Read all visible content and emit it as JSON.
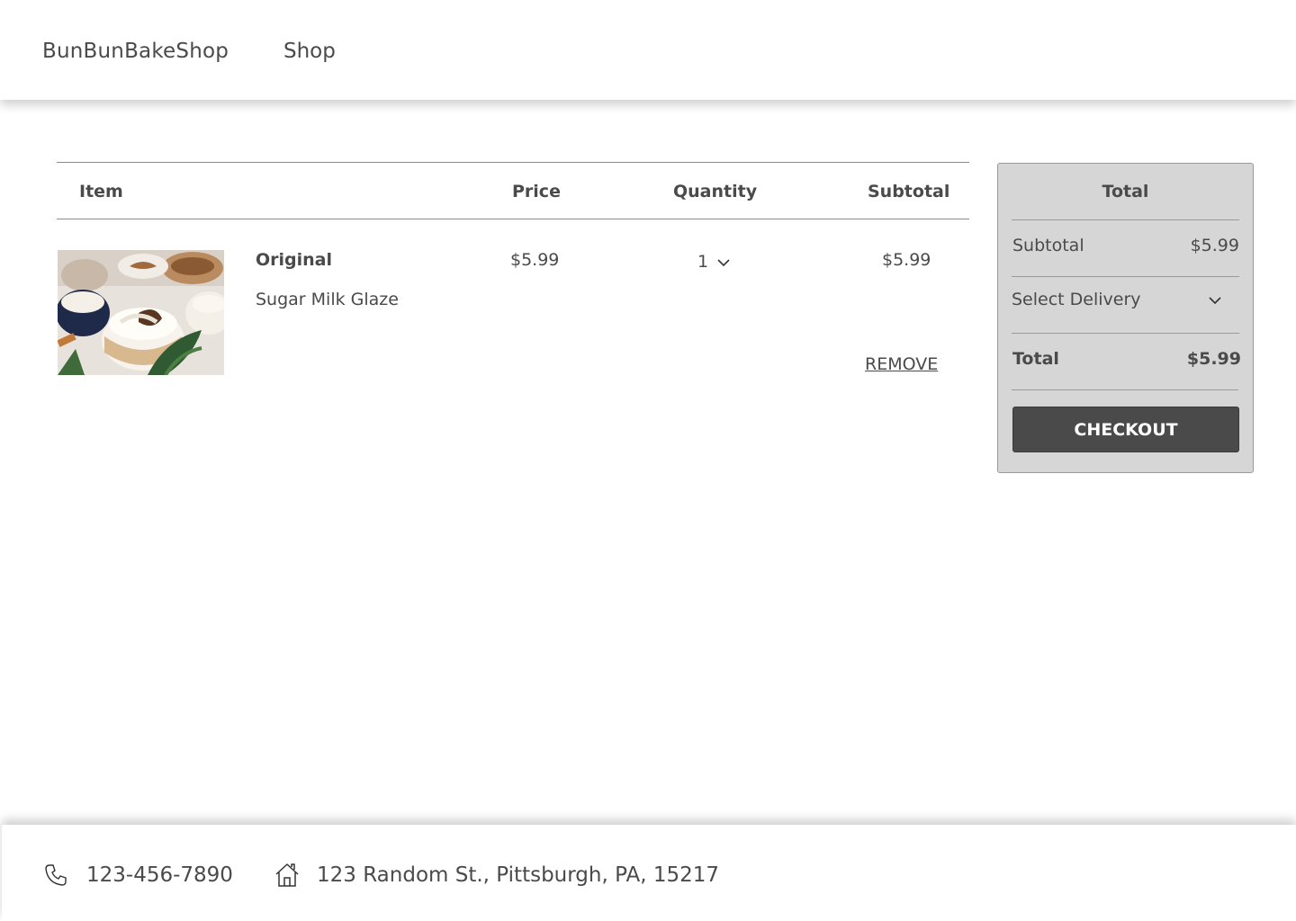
{
  "header": {
    "brand": "BunBunBakeShop",
    "nav_shop": "Shop"
  },
  "cart": {
    "columns": {
      "item": "Item",
      "price": "Price",
      "quantity": "Quantity",
      "subtotal": "Subtotal"
    },
    "items": [
      {
        "name": "Original",
        "variant": "Sugar Milk Glaze",
        "price": "$5.99",
        "quantity": "1",
        "subtotal": "$5.99",
        "remove_label": "REMOVE"
      }
    ]
  },
  "summary": {
    "title": "Total",
    "subtotal_label": "Subtotal",
    "subtotal_value": "$5.99",
    "delivery_placeholder": "Select Delivery",
    "total_label": "Total",
    "total_value": "$5.99",
    "checkout_label": "CHECKOUT"
  },
  "footer": {
    "phone": "123-456-7890",
    "address": "123 Random St., Pittsburgh, PA, 15217"
  },
  "colors": {
    "text": "#4a4a4a",
    "panel_bg": "#d6d6d6",
    "button_bg": "#4a4a4a",
    "button_text": "#ffffff"
  },
  "icons": {
    "quantity_dropdown": "chevron-down-icon",
    "delivery_dropdown": "chevron-down-icon",
    "phone": "phone-icon",
    "address": "home-icon"
  }
}
